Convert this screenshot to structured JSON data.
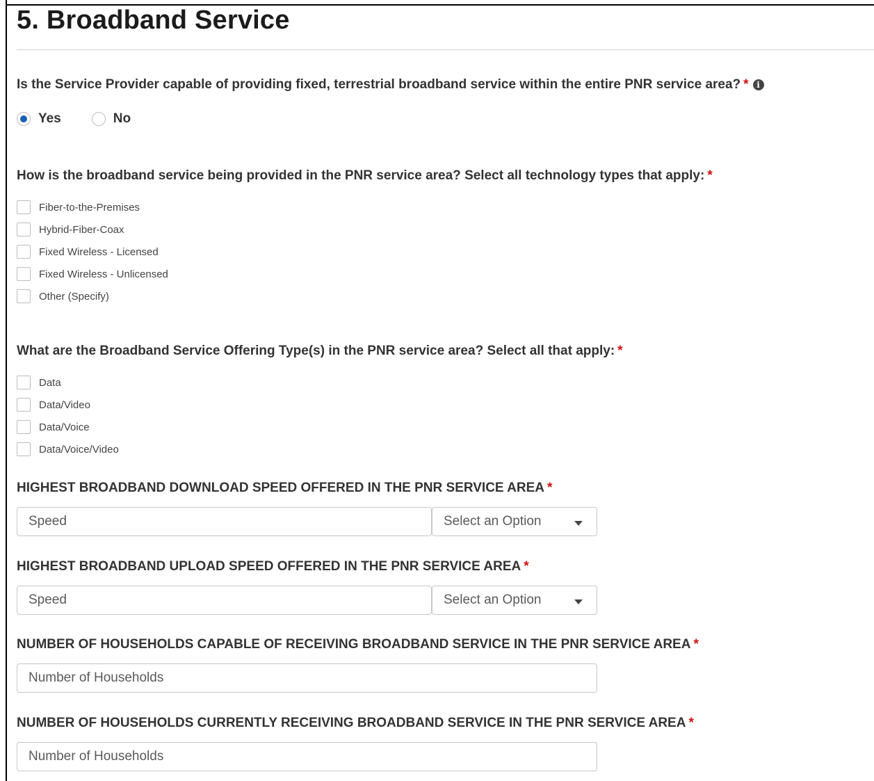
{
  "section": {
    "title": "5. Broadband Service"
  },
  "q1": {
    "text": "Is the Service Provider capable of providing fixed, terrestrial broadband service within the entire PNR service area?",
    "required": "*",
    "info_icon": "info-icon",
    "options": [
      {
        "label": "Yes",
        "checked": true
      },
      {
        "label": "No",
        "checked": false
      }
    ]
  },
  "q2": {
    "text": "How is the broadband service being provided in the PNR service area? Select all technology types that apply:",
    "required": "*",
    "options": [
      "Fiber-to-the-Premises",
      "Hybrid-Fiber-Coax",
      "Fixed Wireless - Licensed",
      "Fixed Wireless - Unlicensed",
      "Other (Specify)"
    ]
  },
  "q3": {
    "text": "What are the Broadband Service Offering Type(s) in the PNR service area? Select all that apply:",
    "required": "*",
    "options": [
      "Data",
      "Data/Video",
      "Data/Voice",
      "Data/Voice/Video"
    ]
  },
  "download": {
    "label": "HIGHEST BROADBAND DOWNLOAD SPEED OFFERED IN THE PNR SERVICE AREA",
    "required": "*",
    "placeholder": "Speed",
    "select_value": "Select an Option"
  },
  "upload": {
    "label": "HIGHEST BROADBAND UPLOAD SPEED OFFERED IN THE PNR SERVICE AREA",
    "required": "*",
    "placeholder": "Speed",
    "select_value": "Select an Option"
  },
  "households_capable": {
    "label": "NUMBER OF HOUSEHOLDS CAPABLE OF RECEIVING BROADBAND SERVICE IN THE PNR SERVICE AREA",
    "required": "*",
    "placeholder": "Number of Households"
  },
  "households_receiving": {
    "label": "NUMBER OF HOUSEHOLDS CURRENTLY RECEIVING BROADBAND SERVICE IN THE PNR SERVICE AREA",
    "required": "*",
    "placeholder": "Number of Households"
  },
  "colors": {
    "required": "#d01010",
    "radio_checked": "#1a5fb4"
  }
}
